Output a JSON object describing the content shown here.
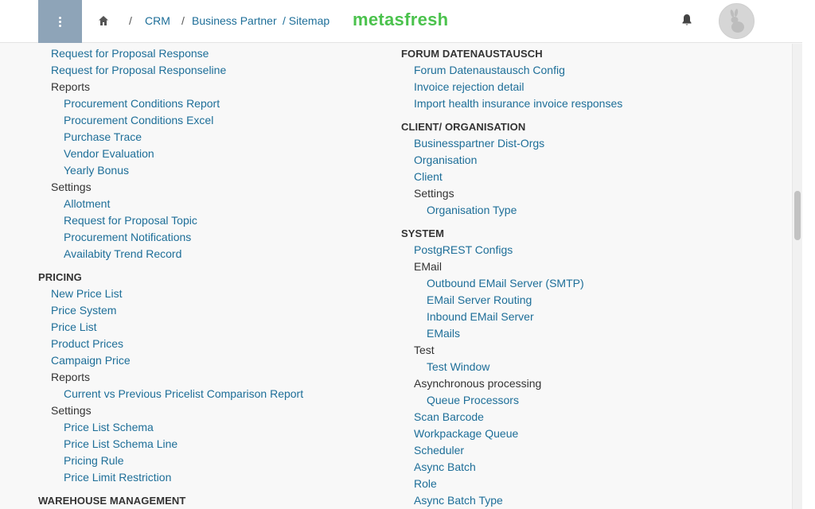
{
  "header": {
    "breadcrumb": {
      "separator": "/",
      "crm": "CRM",
      "business_partner": "Business Partner",
      "sitemap": "/ Sitemap"
    },
    "logo_text": "metasfresh"
  },
  "left_column": {
    "procurement_tail": {
      "rfp_response": "Request for Proposal Response",
      "rfp_responseline": "Request for Proposal Responseline",
      "reports_label": "Reports",
      "reports": [
        "Procurement Conditions Report",
        "Procurement Conditions Excel",
        "Purchase Trace",
        "Vendor Evaluation",
        "Yearly Bonus"
      ],
      "settings_label": "Settings",
      "settings": [
        "Allotment",
        "Request for Proposal Topic",
        "Procurement Notifications",
        "Availabity Trend Record"
      ]
    },
    "pricing": {
      "heading": "PRICING",
      "items": [
        "New Price List",
        "Price System",
        "Price List",
        "Product Prices",
        "Campaign Price"
      ],
      "reports_label": "Reports",
      "reports": [
        "Current vs Previous Pricelist Comparison Report"
      ],
      "settings_label": "Settings",
      "settings": [
        "Price List Schema",
        "Price List Schema Line",
        "Pricing Rule",
        "Price Limit Restriction"
      ]
    },
    "warehouse_heading": "WAREHOUSE MANAGEMENT"
  },
  "right_column": {
    "forum": {
      "heading": "FORUM DATENAUSTAUSCH",
      "items": [
        "Forum Datenaustausch Config",
        "Invoice rejection detail",
        "Import health insurance invoice responses"
      ]
    },
    "client_org": {
      "heading": "CLIENT/ ORGANISATION",
      "items": [
        "Businesspartner Dist-Orgs",
        "Organisation",
        "Client"
      ],
      "settings_label": "Settings",
      "settings": [
        "Organisation Type"
      ]
    },
    "system": {
      "heading": "SYSTEM",
      "postgrest": "PostgREST Configs",
      "email_label": "EMail",
      "email_items": [
        "Outbound EMail Server (SMTP)",
        "EMail Server Routing",
        "Inbound EMail Server",
        "EMails"
      ],
      "test_label": "Test",
      "test_items": [
        "Test Window"
      ],
      "async_label": "Asynchronous processing",
      "async_items": [
        "Queue Processors"
      ],
      "items": [
        "Scan Barcode",
        "Workpackage Queue",
        "Scheduler",
        "Async Batch",
        "Role",
        "Async Batch Type"
      ]
    }
  },
  "colors": {
    "link": "#1d6e98",
    "logo": "#4bc24d",
    "menu_button": "#8ea4b8"
  }
}
